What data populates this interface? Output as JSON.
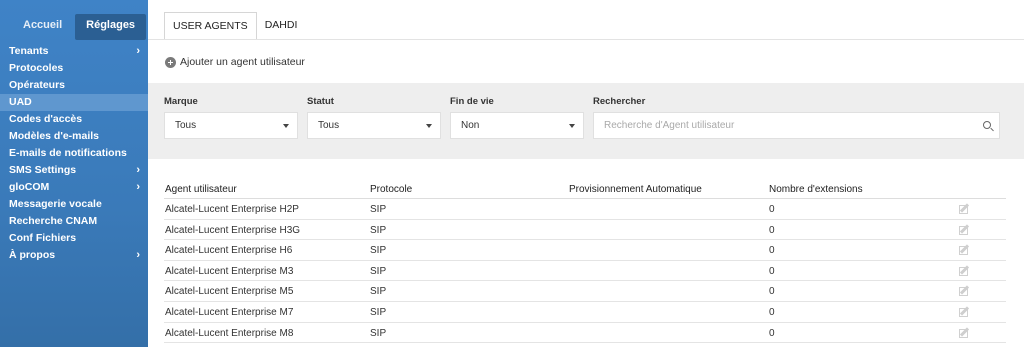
{
  "sidebar": {
    "tabs": [
      {
        "label": "Accueil",
        "active": false
      },
      {
        "label": "Réglages",
        "active": true
      }
    ],
    "items": [
      {
        "label": "Tenants",
        "has_chevron": true,
        "active": false
      },
      {
        "label": "Protocoles",
        "has_chevron": false,
        "active": false
      },
      {
        "label": "Opérateurs",
        "has_chevron": false,
        "active": false
      },
      {
        "label": "UAD",
        "has_chevron": false,
        "active": true
      },
      {
        "label": "Codes d'accès",
        "has_chevron": false,
        "active": false
      },
      {
        "label": "Modèles d'e-mails",
        "has_chevron": false,
        "active": false
      },
      {
        "label": "E-mails de notifications",
        "has_chevron": false,
        "active": false
      },
      {
        "label": "SMS Settings",
        "has_chevron": true,
        "active": false
      },
      {
        "label": "gloCOM",
        "has_chevron": true,
        "active": false
      },
      {
        "label": "Messagerie vocale",
        "has_chevron": false,
        "active": false
      },
      {
        "label": "Recherche CNAM",
        "has_chevron": false,
        "active": false
      },
      {
        "label": "Conf Fichiers",
        "has_chevron": false,
        "active": false
      },
      {
        "label": "À propos",
        "has_chevron": true,
        "active": false
      }
    ],
    "chevron": "›"
  },
  "tabs": [
    {
      "label": "USER AGENTS",
      "active": true
    },
    {
      "label": "DAHDI",
      "active": false
    }
  ],
  "add_button": {
    "label": "Ajouter un agent utilisateur",
    "icon": "plus-circle-icon"
  },
  "filters": {
    "brand": {
      "label": "Marque",
      "value": "Tous"
    },
    "status": {
      "label": "Statut",
      "value": "Tous"
    },
    "eol": {
      "label": "Fin de vie",
      "value": "Non"
    },
    "search": {
      "label": "Rechercher",
      "placeholder": "Recherche d'Agent utilisateur",
      "value": ""
    }
  },
  "table": {
    "columns": [
      "Agent utilisateur",
      "Protocole",
      "Provisionnement Automatique",
      "Nombre d'extensions"
    ],
    "rows": [
      {
        "agent": "Alcatel-Lucent Enterprise H2P",
        "protocol": "SIP",
        "auto_prov": "",
        "extensions": "0"
      },
      {
        "agent": "Alcatel-Lucent Enterprise H3G",
        "protocol": "SIP",
        "auto_prov": "",
        "extensions": "0"
      },
      {
        "agent": "Alcatel-Lucent Enterprise H6",
        "protocol": "SIP",
        "auto_prov": "",
        "extensions": "0"
      },
      {
        "agent": "Alcatel-Lucent Enterprise M3",
        "protocol": "SIP",
        "auto_prov": "",
        "extensions": "0"
      },
      {
        "agent": "Alcatel-Lucent Enterprise M5",
        "protocol": "SIP",
        "auto_prov": "",
        "extensions": "0"
      },
      {
        "agent": "Alcatel-Lucent Enterprise M7",
        "protocol": "SIP",
        "auto_prov": "",
        "extensions": "0"
      },
      {
        "agent": "Alcatel-Lucent Enterprise M8",
        "protocol": "SIP",
        "auto_prov": "",
        "extensions": "0"
      }
    ]
  },
  "colors": {
    "sidebar": "#3f83c7",
    "sidebar_active": "#5f97cf",
    "tab_active_bg": "#2b5f93",
    "filter_bg": "#eeeeee"
  }
}
